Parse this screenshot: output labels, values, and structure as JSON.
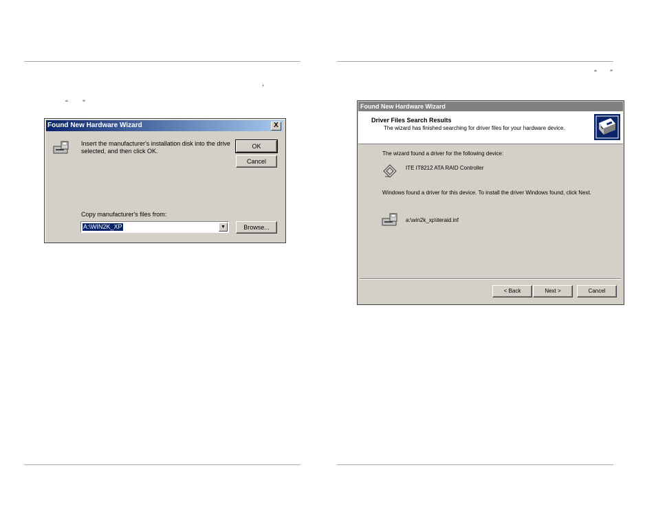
{
  "page": {
    "quote_marks_left": [
      "“",
      "”"
    ],
    "apostrophe_left": "’",
    "quote_marks_right": [
      "“",
      "”"
    ]
  },
  "dialog1": {
    "title": "Found New Hardware Wizard",
    "close_label": "X",
    "message": "Insert the manufacturer's installation disk into the drive selected, and then click OK.",
    "ok_label": "OK",
    "cancel_label": "Cancel",
    "copy_from_label": "Copy manufacturer's files from:",
    "copy_from_value": "A:\\WIN2K_XP",
    "browse_label": "Browse..."
  },
  "dialog2": {
    "title": "Found New Hardware Wizard",
    "header_title": "Driver Files Search Results",
    "header_subtitle": "The wizard has finished searching for driver files for your hardware device.",
    "found_text": "The wizard found a driver for the following device:",
    "device_name": "ITE IT8212 ATA RAID Controller",
    "install_text": "Windows found a driver for this device. To install the driver Windows found, click Next.",
    "driver_path": "a:\\win2k_xp\\iteraid.inf",
    "back_label": "< Back",
    "next_label": "Next >",
    "cancel_label": "Cancel"
  }
}
